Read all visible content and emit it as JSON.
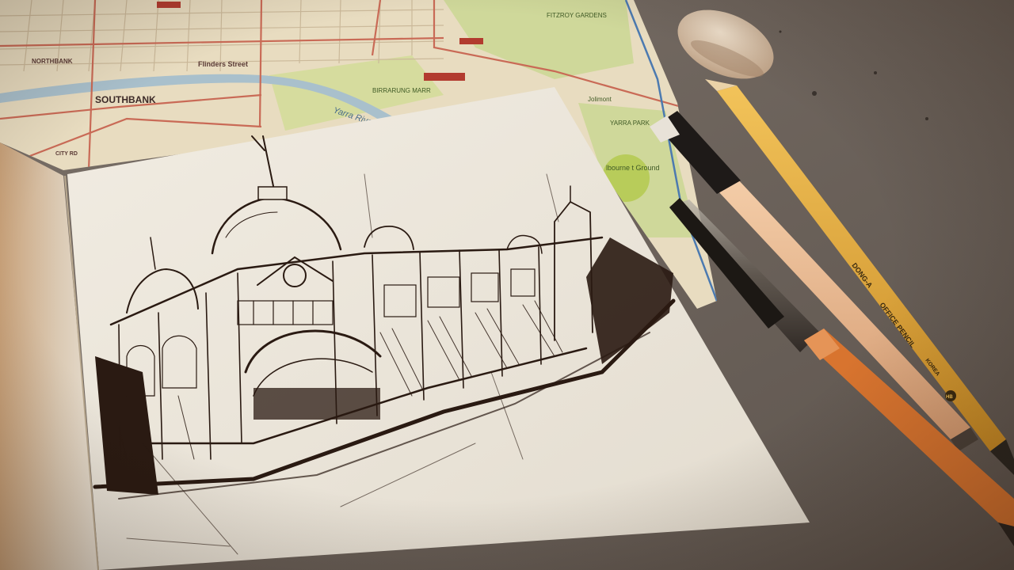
{
  "photo_description_colors": {
    "desk": "#6f665e",
    "map_base": "#e8dcc0",
    "map_park": "#cfd89a",
    "river": "#a9c0cc",
    "sketch_paper": "#ece6da",
    "ink": "#2a1a12",
    "pencil_yellow": "#e2a83a",
    "pencil_peach": "#e9b991",
    "pen_orange": "#d8742f",
    "eraser": "#d8c0a6"
  },
  "map_labels": {
    "southbank": "SOUTHBANK",
    "northbank": "NORTHBANK",
    "yarra_river": "Yarra River",
    "birrarung_marr": "BIRRARUNG MARR",
    "yarra_park": "YARRA PARK",
    "fitzroy_gardens": "FITZROY GARDENS",
    "flinders_street": "Flinders Street",
    "jolimont": "Jolimont",
    "melbourne_ground": "lbourne t Ground",
    "city_rd": "CITY RD"
  },
  "pencil_print": {
    "brand": "DONG-A",
    "model": "OFFICE PENCIL",
    "origin": "KOREA",
    "grade": "HB"
  }
}
